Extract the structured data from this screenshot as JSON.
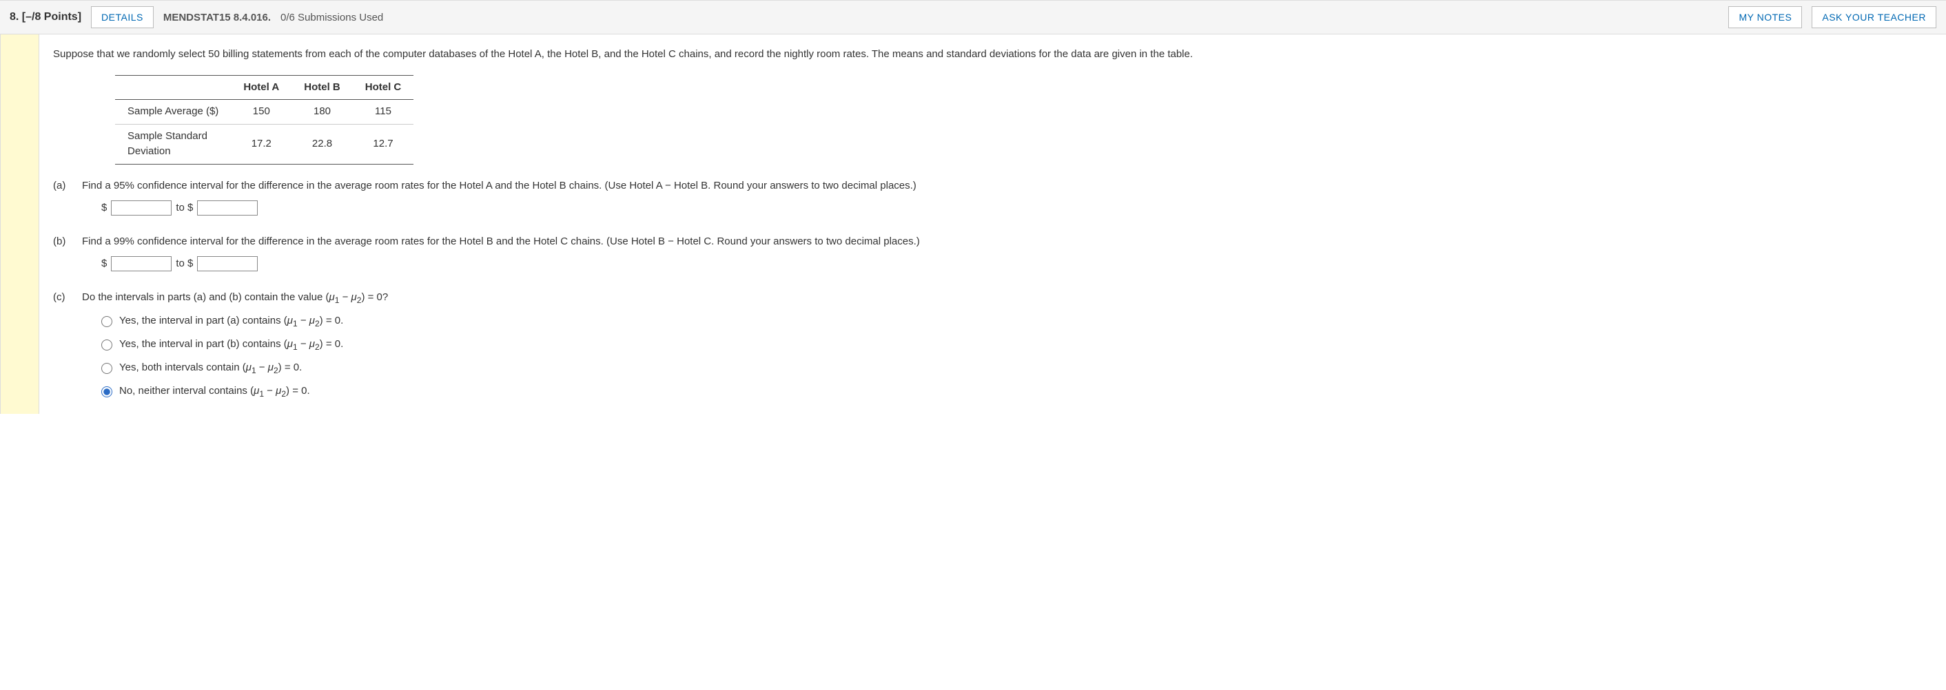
{
  "header": {
    "number_points": "8.  [–/8 Points]",
    "details_btn": "DETAILS",
    "ref_code": "MENDSTAT15 8.4.016.",
    "submissions": "0/6 Submissions Used",
    "my_notes_btn": "MY NOTES",
    "ask_teacher_btn": "ASK YOUR TEACHER"
  },
  "intro": "Suppose that we randomly select 50 billing statements from each of the computer databases of the Hotel A, the Hotel B, and the Hotel C chains, and record the nightly room rates. The means and standard deviations for the data are given in the table.",
  "table": {
    "col_blank": "",
    "col_a": "Hotel A",
    "col_b": "Hotel B",
    "col_c": "Hotel C",
    "row1_label": "Sample Average ($)",
    "row1_a": "150",
    "row1_b": "180",
    "row1_c": "115",
    "row2_label": "Sample Standard Deviation",
    "row2_a": "17.2",
    "row2_b": "22.8",
    "row2_c": "12.7"
  },
  "parts": {
    "a": {
      "label": "(a)",
      "text": "Find a 95% confidence interval for the difference in the average room rates for the Hotel A and the Hotel B chains. (Use Hotel A − Hotel B. Round your answers to two decimal places.)",
      "dollar1": "$",
      "to": "to $"
    },
    "b": {
      "label": "(b)",
      "text": "Find a 99% confidence interval for the difference in the average room rates for the Hotel B and the Hotel C chains. (Use Hotel B − Hotel C. Round your answers to two decimal places.)",
      "dollar1": "$",
      "to": "to $"
    },
    "c": {
      "label": "(c)",
      "prompt_pre": "Do the intervals in parts (a) and (b) contain the value (",
      "prompt_post": ") = 0?",
      "opt1_pre": "Yes, the interval in part (a) contains (",
      "opt1_post": ") = 0.",
      "opt2_pre": "Yes, the interval in part (b) contains (",
      "opt2_post": ") = 0.",
      "opt3_pre": "Yes, both intervals contain (",
      "opt3_post": ") = 0.",
      "opt4_pre": "No, neither interval contains (",
      "opt4_post": ") = 0."
    }
  },
  "math": {
    "mu1": "μ",
    "sub1": "1",
    "minus": " − ",
    "mu2": "μ",
    "sub2": "2"
  }
}
